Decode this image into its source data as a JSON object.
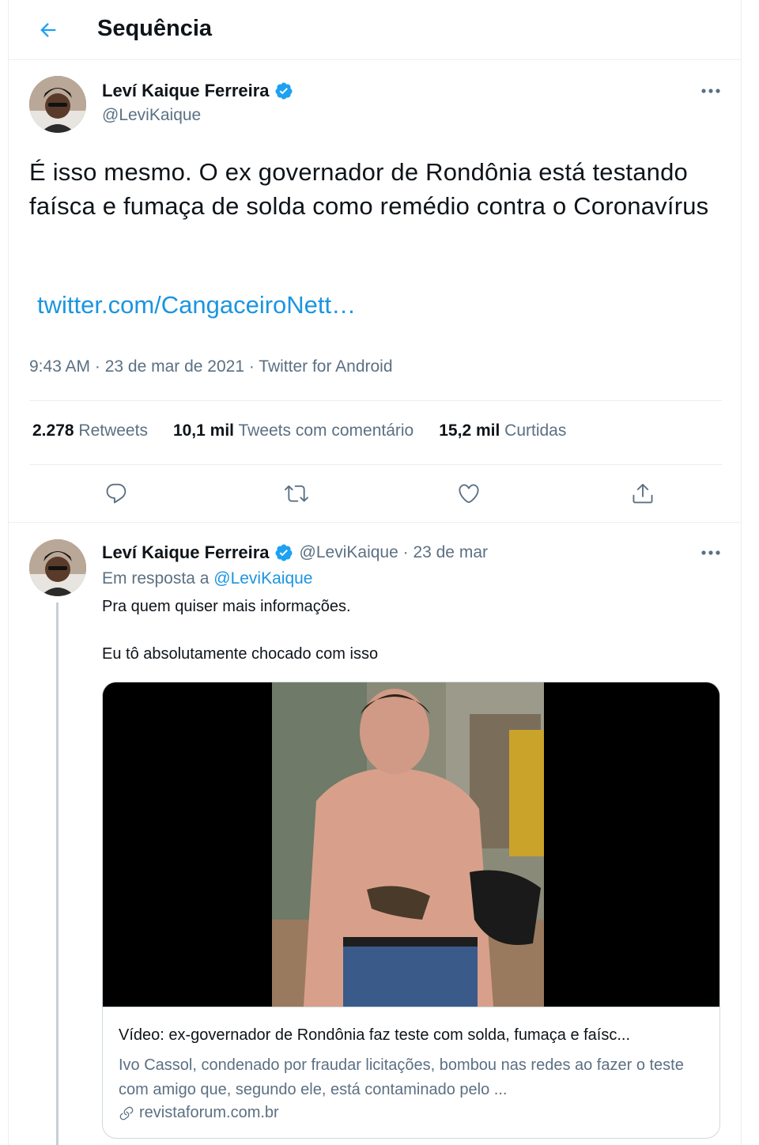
{
  "header": {
    "title": "Sequência"
  },
  "main_tweet": {
    "display_name": "Leví Kaique Ferreira",
    "handle": "@LeviKaique",
    "text": "É isso mesmo. O ex governador de Rondônia está testando faísca e fumaça de solda como remédio contra o Coronavírus",
    "link": "twitter.com/CangaceiroNett…",
    "meta": "9:43 AM · 23 de mar de 2021 · Twitter for Android",
    "stats": {
      "retweets_num": "2.278",
      "retweets_label": "Retweets",
      "comments_num": "10,1 mil",
      "comments_label": "Tweets com comentário",
      "likes_num": "15,2 mil",
      "likes_label": "Curtidas"
    }
  },
  "reply_tweet": {
    "display_name": "Leví Kaique Ferreira",
    "handle_date": "@LeviKaique · 23 de mar",
    "reply_prefix": "Em resposta a",
    "reply_mention": "@LeviKaique",
    "line1": "Pra quem quiser mais informações.",
    "line2": "Eu tô absolutamente chocado com isso",
    "card": {
      "title": "Vídeo: ex-governador de Rondônia faz teste com solda, fumaça e faísc...",
      "description": "Ivo Cassol, condenado por fraudar licitações, bombou nas redes ao fazer o teste com amigo que, segundo ele, está contaminado pelo ...",
      "domain": "revistaforum.com.br"
    }
  },
  "icons": {
    "back": "arrow-left-icon",
    "verified": "verified-badge-icon",
    "more": "more-dots-icon",
    "reply": "reply-icon",
    "retweet": "retweet-icon",
    "like": "heart-icon",
    "share": "share-icon",
    "link": "link-icon"
  },
  "colors": {
    "accent": "#1da1f2",
    "link": "#1b95e0",
    "secondary_text": "#5b7083",
    "border": "#ebeef0"
  }
}
